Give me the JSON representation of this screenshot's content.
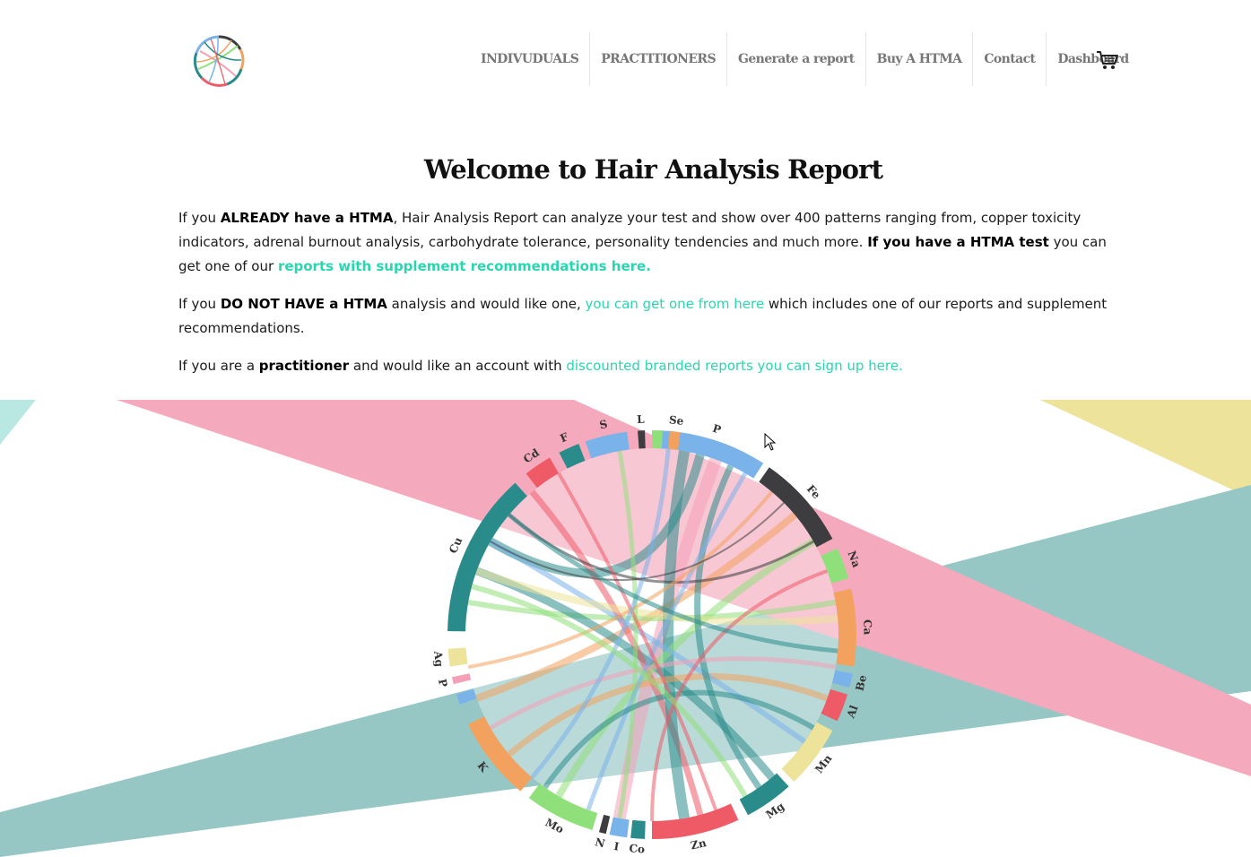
{
  "header": {
    "nav": [
      {
        "label": "INDIVUDUALS"
      },
      {
        "label": "PRACTITIONERS"
      },
      {
        "label": "Generate a report"
      },
      {
        "label": "Buy A HTMA"
      },
      {
        "label": "Contact"
      },
      {
        "label": "Dashboard"
      }
    ],
    "cart_icon": "cart-icon",
    "logo_icon": "chord-logo-icon"
  },
  "main": {
    "title": "Welcome to Hair Analysis Report",
    "p1": {
      "t1": "If you ",
      "b1": "ALREADY have a HTMA",
      "t2": ", Hair Analysis Report can analyze your test and show over 400 patterns ranging from, copper toxicity indicators, adrenal burnout analysis, carbohydrate tolerance, personality tendencies and much more. ",
      "b2": "If you have a HTMA test",
      "t3": " you can get one of our ",
      "link": "reports with supplement recommendations here."
    },
    "p2": {
      "t1": "If you ",
      "b1": "DO NOT HAVE a HTMA",
      "t2": " analysis and would like one, ",
      "link": "you can get one from here",
      "t3": " which includes one of our reports and supplement recommendations."
    },
    "p3": {
      "t1": "If you are a ",
      "b1": "practitioner",
      "t2": " and would like an account with ",
      "link": "discounted branded reports you can sign up here."
    }
  },
  "chord": {
    "labels": [
      "P",
      "Fe",
      "Na",
      "Ca",
      "Be",
      "Al",
      "Mn",
      "Mg",
      "Zn",
      "Co",
      "I",
      "N",
      "Mo",
      "K",
      "P",
      "Ag",
      "Cu",
      "Cd",
      "F",
      "S",
      "L",
      "Se"
    ],
    "colors": {
      "teal": "#2a8c8a",
      "pink": "#f4a0b6",
      "yellow": "#ede39a",
      "blue": "#7ab2ea",
      "dark": "#3d3d40",
      "green": "#8fe07a",
      "orange": "#f2a25e",
      "red": "#ee5a66"
    }
  }
}
